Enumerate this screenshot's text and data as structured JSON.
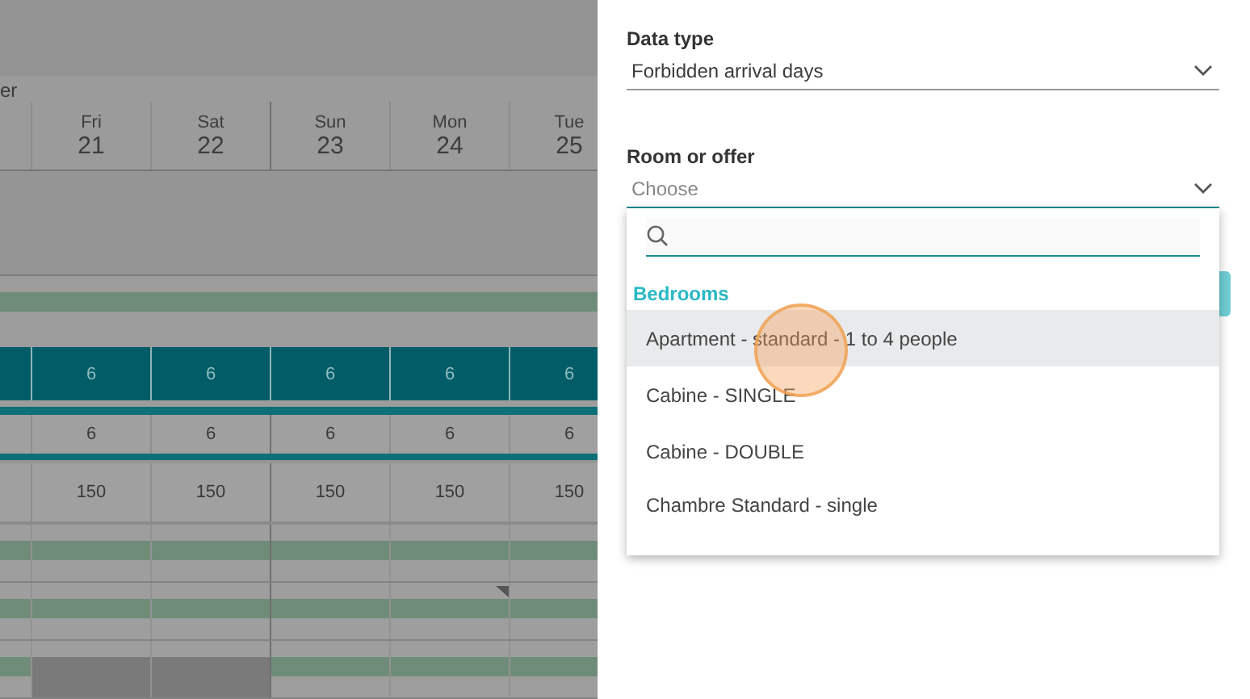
{
  "calendar": {
    "month_fragment": "er",
    "days": [
      {
        "dow": "Fri",
        "day": "21"
      },
      {
        "dow": "Sat",
        "day": "22"
      },
      {
        "dow": "Sun",
        "day": "23"
      },
      {
        "dow": "Mon",
        "day": "24"
      },
      {
        "dow": "Tue",
        "day": "25"
      }
    ],
    "availability": [
      "6",
      "6",
      "6",
      "6",
      "6"
    ],
    "stock": [
      "6",
      "6",
      "6",
      "6",
      "6"
    ],
    "prices": [
      "150",
      "150",
      "150",
      "150",
      "150"
    ],
    "stripe_rows": [
      {
        "cells": [
          {
            "blocked": false
          },
          {
            "blocked": false
          },
          {
            "blocked": false
          },
          {
            "blocked": false
          },
          {
            "blocked": false
          },
          {
            "blocked": false
          }
        ]
      },
      {
        "cells": [
          {
            "blocked": false
          },
          {
            "blocked": false
          },
          {
            "blocked": false
          },
          {
            "blocked": false
          },
          {
            "blocked": false,
            "flagged": true
          },
          {
            "blocked": false
          }
        ]
      },
      {
        "cells": [
          {
            "blocked": false
          },
          {
            "blocked": true
          },
          {
            "blocked": true
          },
          {
            "blocked": false
          },
          {
            "blocked": false
          },
          {
            "blocked": false
          }
        ]
      }
    ]
  },
  "panel": {
    "data_type": {
      "label": "Data type",
      "value": "Forbidden arrival days"
    },
    "room": {
      "label": "Room or offer",
      "placeholder": "Choose",
      "expanded": true
    },
    "dropdown": {
      "group": "Bedrooms",
      "options": [
        {
          "label": "Apartment - standard - 1 to 4 people",
          "selected": true
        },
        {
          "label": "Cabine - SINGLE",
          "selected": false
        },
        {
          "label": "Cabine - DOUBLE",
          "selected": false
        },
        {
          "label": "Chambre Standard - single",
          "selected": false
        }
      ]
    }
  }
}
